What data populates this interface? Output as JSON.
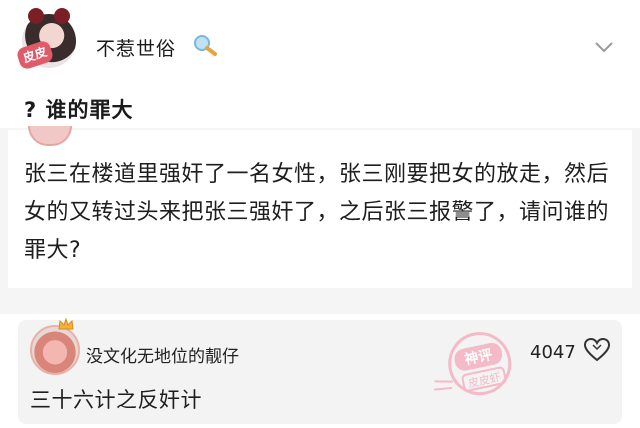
{
  "header": {
    "username": "不惹世俗",
    "username_emoji": "magnifier-icon",
    "avatar_badge": "皮皮",
    "menu_icon": "chevron-down-icon"
  },
  "post": {
    "title": "? 谁的罪大",
    "body": "张三在楼道里强奸了一名女性，张三刚要把女的放走，然后女的又转过头来把张三强奸了，之后张三报警了，请问谁的罪大?"
  },
  "comment": {
    "author": "没文化无地位的靓仔",
    "likes": "4047",
    "text": "三十六计之反奸计",
    "badge": "神评",
    "badge_sub": "皮皮虾",
    "accent": "#f06a8a"
  },
  "colors": {
    "background": "#ffffff",
    "band": "#f5f5f6",
    "comment_bg": "#f3f3f4",
    "watermark": "#f6a7b8"
  }
}
